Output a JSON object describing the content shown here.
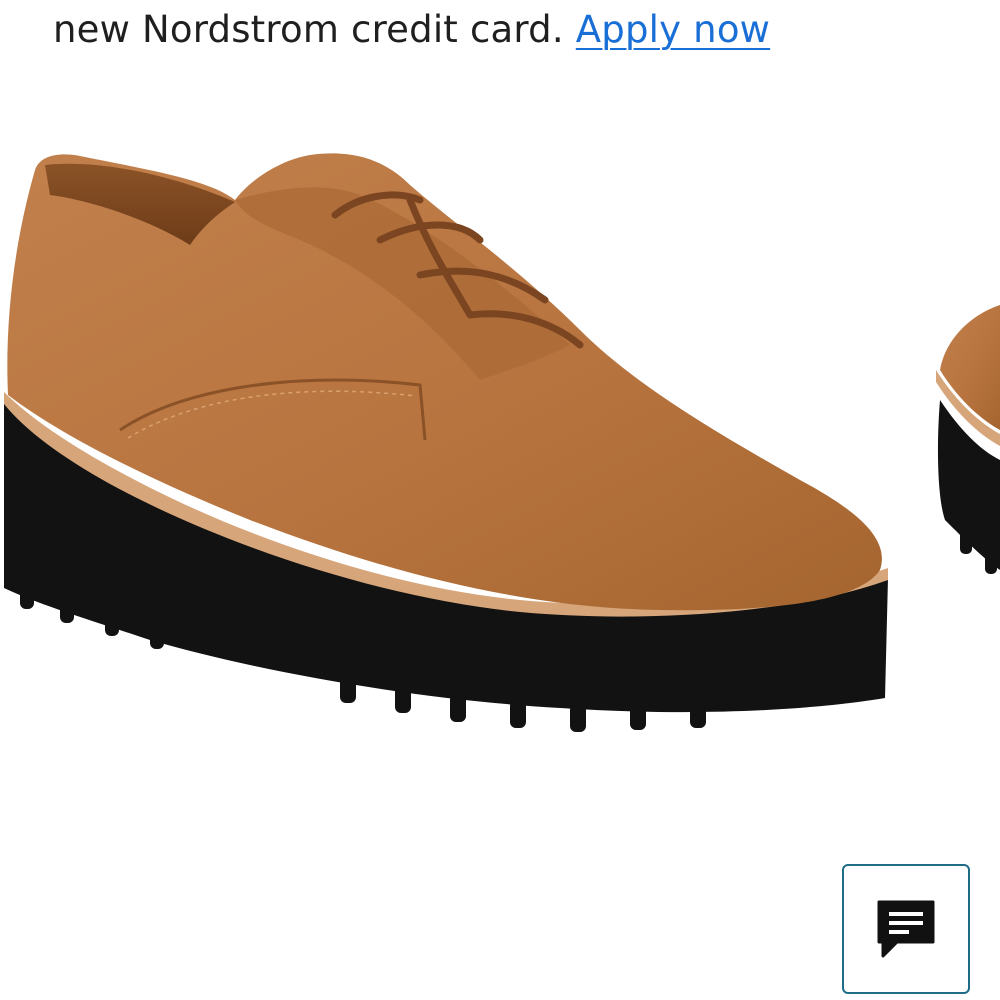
{
  "promo": {
    "text": "new Nordstrom credit card.",
    "link_label": "Apply now"
  },
  "product_image": {
    "description_icon": "product-photo",
    "colors": {
      "suede": "#b8743f",
      "sole": "#121212",
      "welt": "#d6a57a"
    }
  },
  "chat": {
    "icon": "chat-bubble-icon",
    "border_color": "#1e6c86"
  }
}
